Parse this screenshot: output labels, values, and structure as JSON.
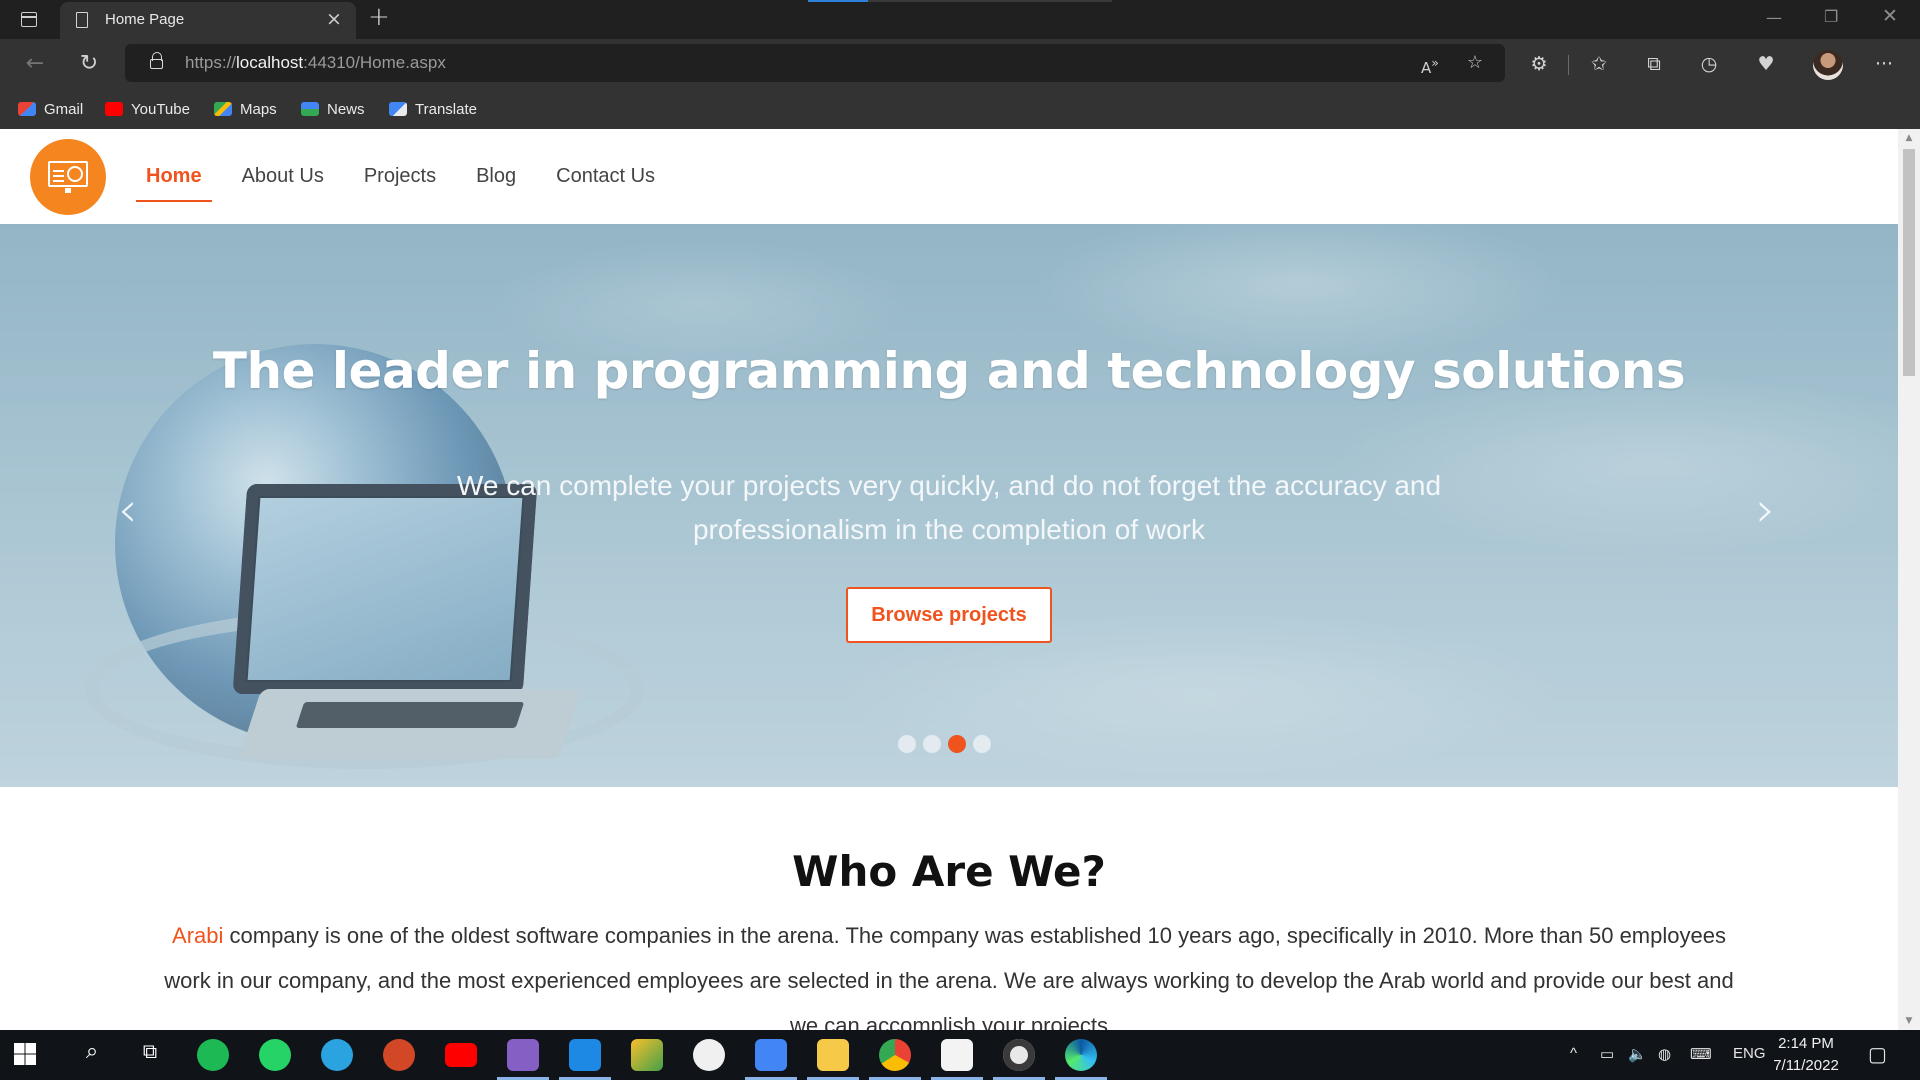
{
  "browser": {
    "tab_title": "Home Page",
    "url_scheme": "https://",
    "url_host": "localhost",
    "url_rest": ":44310/Home.aspx",
    "favorites": [
      {
        "label": "Gmail",
        "color": "#ea4335"
      },
      {
        "label": "YouTube",
        "color": "#ff0000"
      },
      {
        "label": "Maps",
        "color": "#34a853"
      },
      {
        "label": "News",
        "color": "#4285f4"
      },
      {
        "label": "Translate",
        "color": "#4285f4"
      }
    ]
  },
  "site": {
    "nav": {
      "items": [
        "Home",
        "About Us",
        "Projects",
        "Blog",
        "Contact Us"
      ],
      "active": "Home"
    },
    "hero": {
      "title": "The leader in programming and technology solutions",
      "subtitle": "We can complete your projects very quickly, and do not forget the accuracy and professionalism in the completion of work",
      "button": "Browse projects",
      "prev_arrow": "‹",
      "next_arrow": "›",
      "slide_count": 4,
      "active_slide": 3
    },
    "about": {
      "title": "Who Are We?",
      "brand": "Arabi",
      "text": " company is one of the oldest software companies in the arena. The company was established 10 years ago, specifically in 2010. More than 50 employees work in our company, and the most experienced employees are selected in the arena. We are always working to develop the Arab world and provide our best and we can accomplish your projects"
    },
    "accent_color": "#f0541e"
  },
  "taskbar": {
    "language": "ENG",
    "time": "2:14 PM",
    "date": "7/11/2022"
  }
}
